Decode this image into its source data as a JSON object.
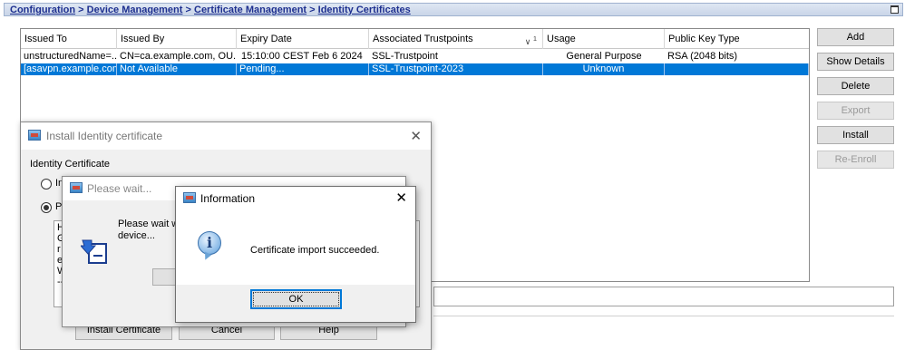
{
  "breadcrumb": {
    "items": [
      "Configuration",
      "Device Management",
      "Certificate Management",
      "Identity Certificates"
    ],
    "separator": ">"
  },
  "table": {
    "columns": [
      "Issued To",
      "Issued By",
      "Expiry Date",
      "Associated Trustpoints",
      "Usage",
      "Public Key Type"
    ],
    "sort_indicator": "1",
    "rows": [
      [
        "unstructuredName=...",
        "CN=ca.example.com, OU...",
        "15:10:00 CEST Feb 6 2024",
        "SSL-Trustpoint",
        "General Purpose",
        "RSA (2048 bits)"
      ],
      [
        "[asavpn.example.com]",
        "Not Available",
        "Pending...",
        "SSL-Trustpoint-2023",
        "Unknown",
        ""
      ]
    ],
    "selected_row": 1
  },
  "side_buttons": {
    "add": "Add",
    "show_details": "Show Details",
    "delete": "Delete",
    "export": "Export",
    "install": "Install",
    "re_enroll": "Re-Enroll"
  },
  "install_dialog": {
    "title": "Install Identity certificate",
    "group_label": "Identity Certificate",
    "radio1_label": "In",
    "radio2_label": "Pa",
    "text_lines": [
      "H",
      "G",
      "r",
      "el",
      "W",
      "--"
    ],
    "buttons": [
      "Install Certificate",
      "Cancel",
      "Help"
    ]
  },
  "wait_dialog": {
    "title": "Please wait...",
    "message_line1": "Please wait wh",
    "message_line2": "device..."
  },
  "info_dialog": {
    "title": "Information",
    "message": "Certificate import succeeded.",
    "ok_label": "OK"
  },
  "colors": {
    "selection": "#0078d7",
    "breadcrumb_text": "#1d2f8f",
    "dialog_bg": "#f0f0f0"
  }
}
